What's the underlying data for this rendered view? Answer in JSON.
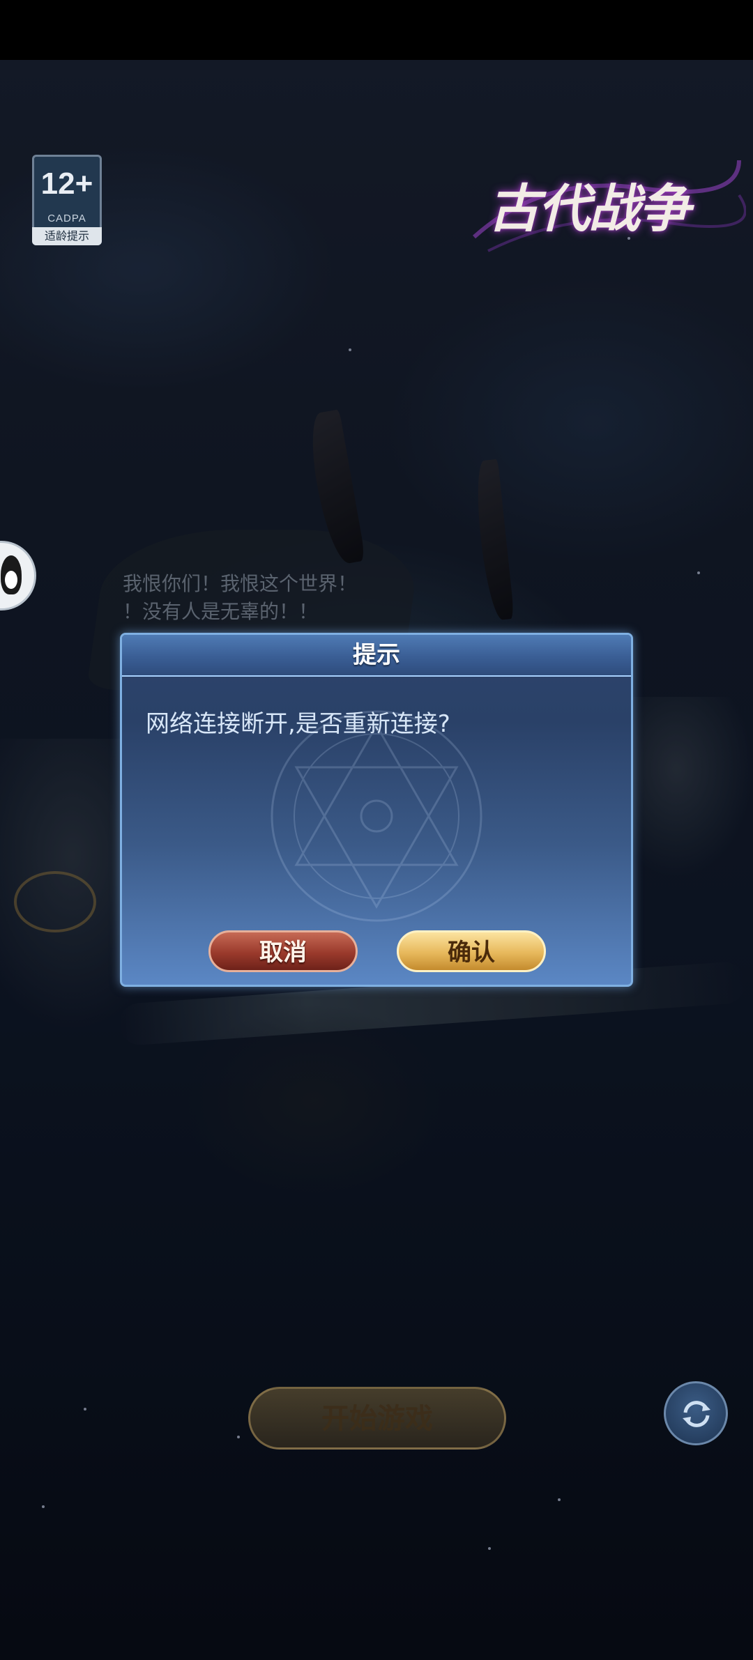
{
  "age_rating": {
    "number": "12+",
    "org": "CADPA",
    "tip": "适龄提示"
  },
  "logo": {
    "text": "古代战争"
  },
  "quote": {
    "line1": "我恨你们！我恨这个世界！",
    "line2": "！没有人是无辜的！！"
  },
  "dialog": {
    "title": "提示",
    "message": "网络连接断开,是否重新连接?",
    "cancel_label": "取消",
    "confirm_label": "确认"
  },
  "start_button": {
    "label": "开始游戏"
  },
  "icons": {
    "qq": "qq-penguin-icon",
    "refresh": "refresh-icon"
  }
}
